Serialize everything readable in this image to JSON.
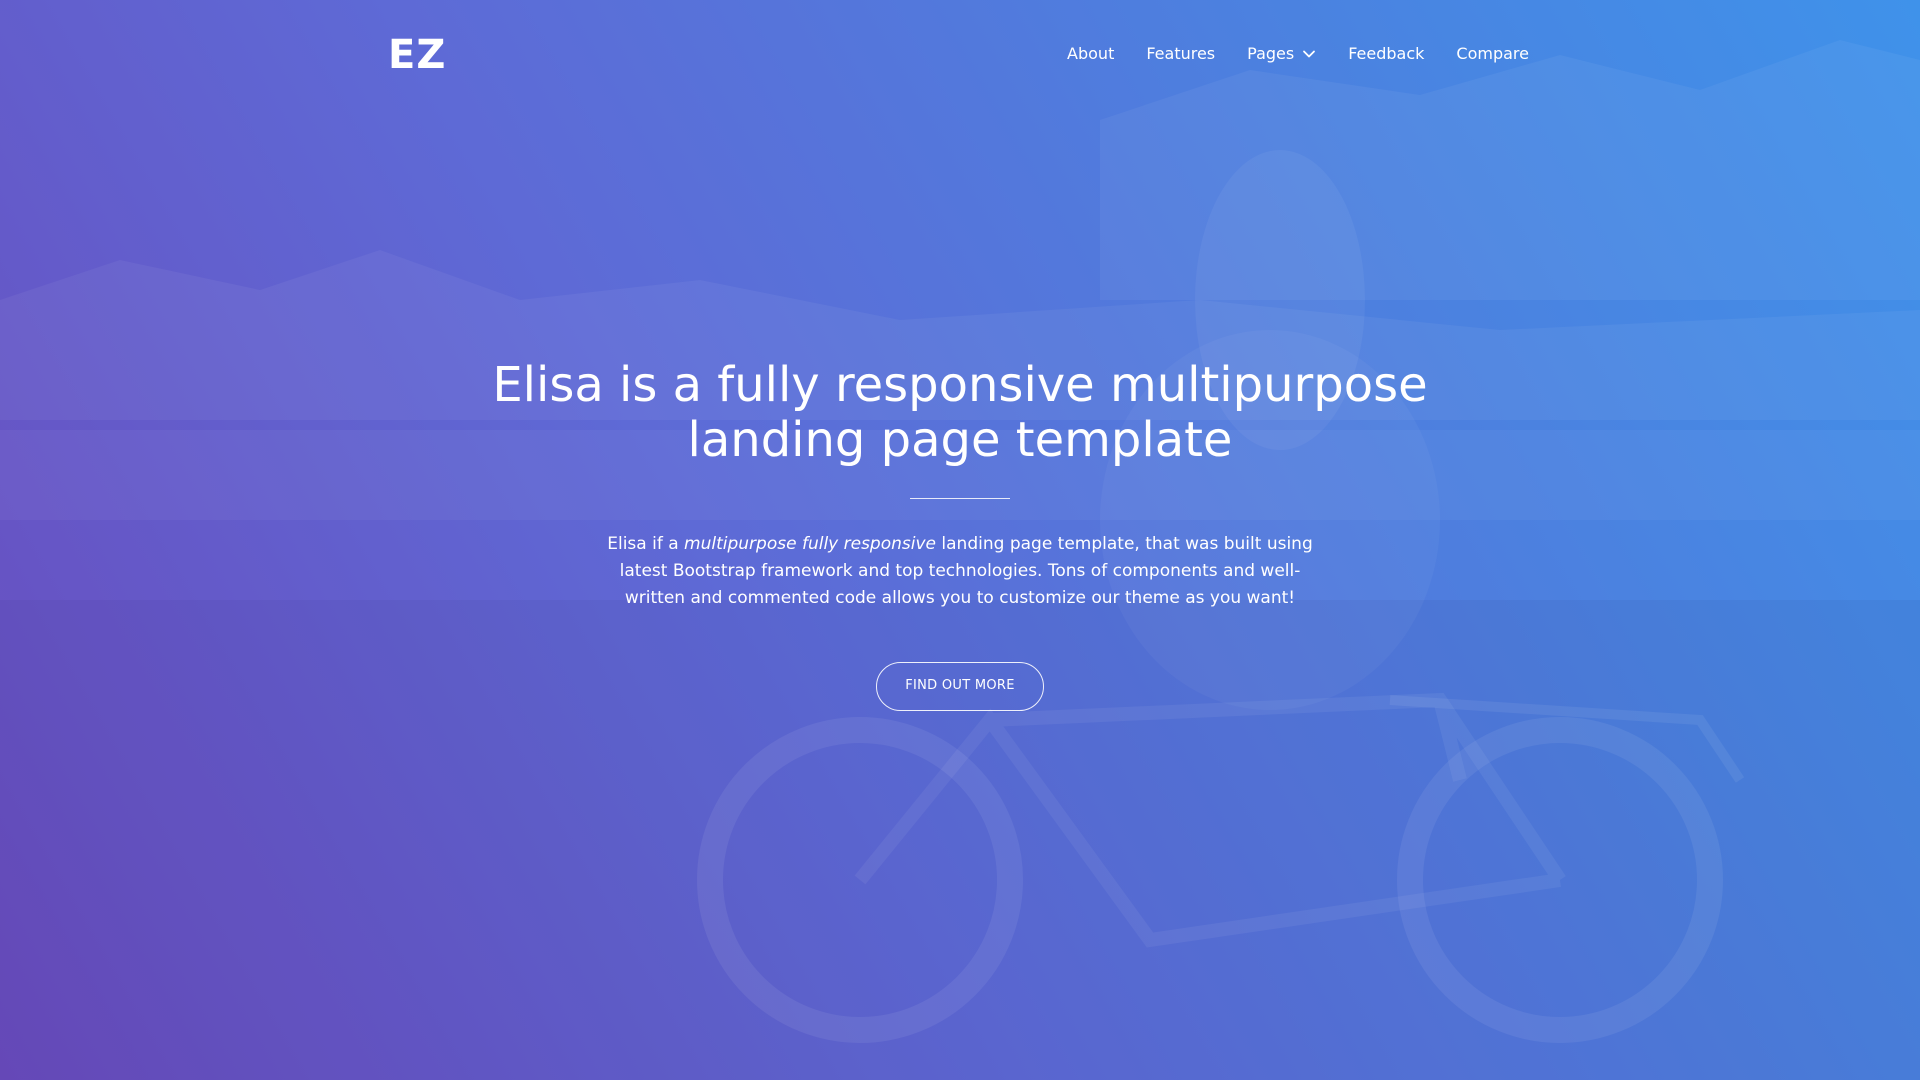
{
  "brand": {
    "logo_text": "EZ"
  },
  "nav": {
    "items": [
      {
        "label": "About"
      },
      {
        "label": "Features"
      },
      {
        "label": "Pages",
        "icon": "chevron-down-icon"
      },
      {
        "label": "Feedback"
      },
      {
        "label": "Compare"
      }
    ]
  },
  "hero": {
    "headline_line1": "Elisa is a fully responsive multipurpose",
    "headline_line2": "landing page template",
    "lead_before": "Elisa if a ",
    "lead_emphasis": "multipurpose fully responsive",
    "lead_after": " landing page template, that was built using latest Bootstrap framework and top technologies. Tons of components and well-written and commented code allows you to customize our theme as you want!",
    "cta_label": "FIND OUT MORE"
  },
  "colors": {
    "gradient_start": "#6a4bbd",
    "gradient_mid": "#5e6ad6",
    "gradient_end": "#3f92ea",
    "text": "#ffffff"
  }
}
